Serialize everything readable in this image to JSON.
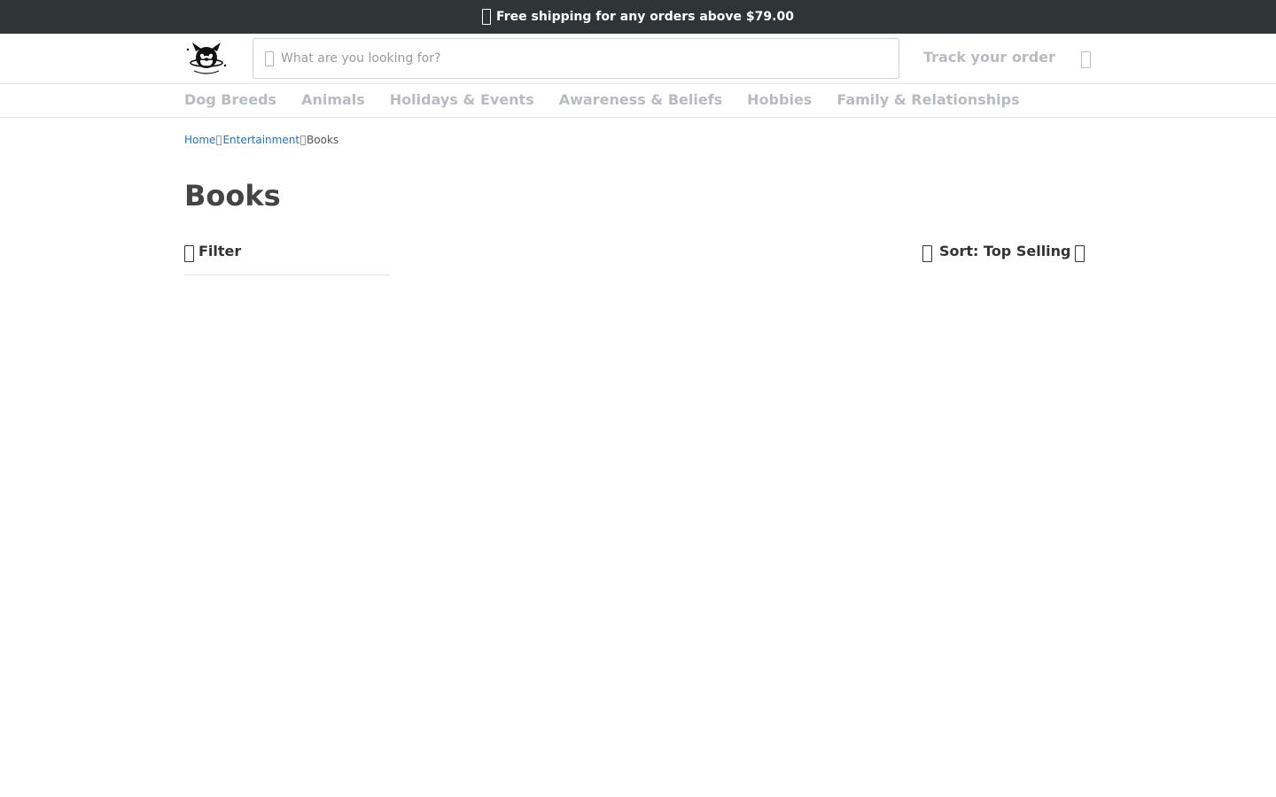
{
  "promo": {
    "text": "Free shipping for any orders above $79.00"
  },
  "header": {
    "logo_alt": "Dog cartoon logo",
    "search_placeholder": "What are you looking for?",
    "search_value": "",
    "track_label": "Track your order"
  },
  "nav": {
    "items": [
      {
        "label": "Dog Breeds"
      },
      {
        "label": "Animals"
      },
      {
        "label": "Holidays & Events"
      },
      {
        "label": "Awareness & Beliefs"
      },
      {
        "label": "Hobbies"
      },
      {
        "label": "Family & Relationships"
      }
    ]
  },
  "breadcrumb": {
    "items": [
      {
        "label": "Home"
      },
      {
        "label": "Entertainment"
      },
      {
        "label": "Books"
      }
    ]
  },
  "page": {
    "title": "Books",
    "filter_label": "Filter",
    "sort_label": "Sort: Top Selling"
  },
  "colors": {
    "promo_bg": "#2f3437",
    "nav_text": "#b8bcc0",
    "link": "#1a73c8",
    "title": "#444444"
  },
  "icons": {
    "promo": "shipping-icon",
    "search": "search-icon",
    "cart": "cart-icon",
    "breadcrumb_sep": "chevron-right-icon",
    "filter": "filter-icon",
    "sort": "sort-icon",
    "sort_chevron": "chevron-down-icon"
  }
}
